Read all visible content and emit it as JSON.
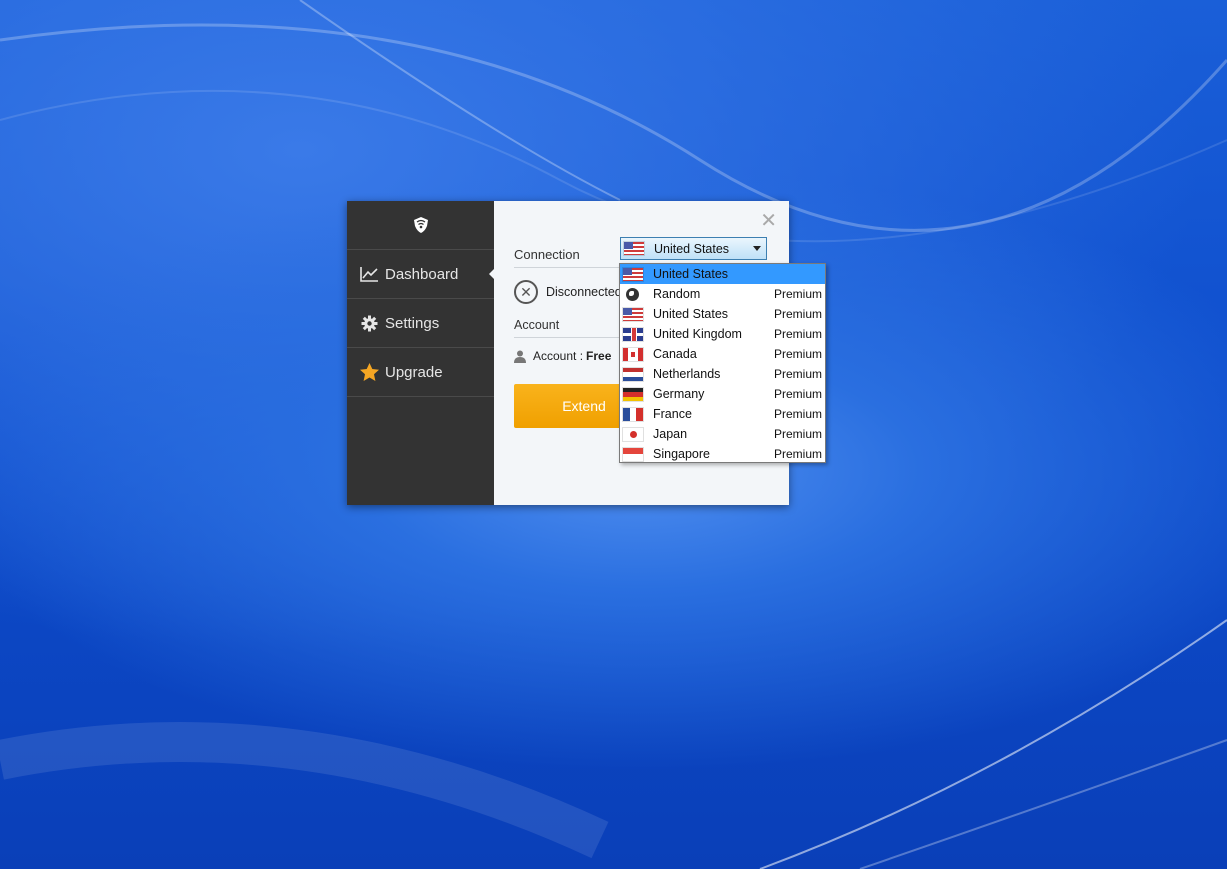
{
  "sidebar": {
    "items": [
      {
        "label": "Dashboard",
        "icon": "chart-line-icon"
      },
      {
        "label": "Settings",
        "icon": "gear-icon"
      },
      {
        "label": "Upgrade",
        "icon": "star-icon"
      }
    ]
  },
  "main": {
    "connection_label": "Connection",
    "status": "Disconnected",
    "account_label": "Account",
    "account_prefix": "Account :",
    "account_type": "Free",
    "extend_button": "Extend"
  },
  "server_select": {
    "selected": "United States",
    "options": [
      {
        "name": "United States",
        "tier": "",
        "flag": "us"
      },
      {
        "name": "Random",
        "tier": "Premium",
        "flag": "globe"
      },
      {
        "name": "United States",
        "tier": "Premium",
        "flag": "us"
      },
      {
        "name": "United Kingdom",
        "tier": "Premium",
        "flag": "uk"
      },
      {
        "name": "Canada",
        "tier": "Premium",
        "flag": "ca"
      },
      {
        "name": "Netherlands",
        "tier": "Premium",
        "flag": "nl"
      },
      {
        "name": "Germany",
        "tier": "Premium",
        "flag": "de"
      },
      {
        "name": "France",
        "tier": "Premium",
        "flag": "fr"
      },
      {
        "name": "Japan",
        "tier": "Premium",
        "flag": "jp"
      },
      {
        "name": "Singapore",
        "tier": "Premium",
        "flag": "sg"
      }
    ]
  },
  "colors": {
    "sidebar_bg": "#333333",
    "main_bg": "#f3f6f9",
    "accent_orange": "#f0a000",
    "selection_blue": "#3399ff"
  }
}
